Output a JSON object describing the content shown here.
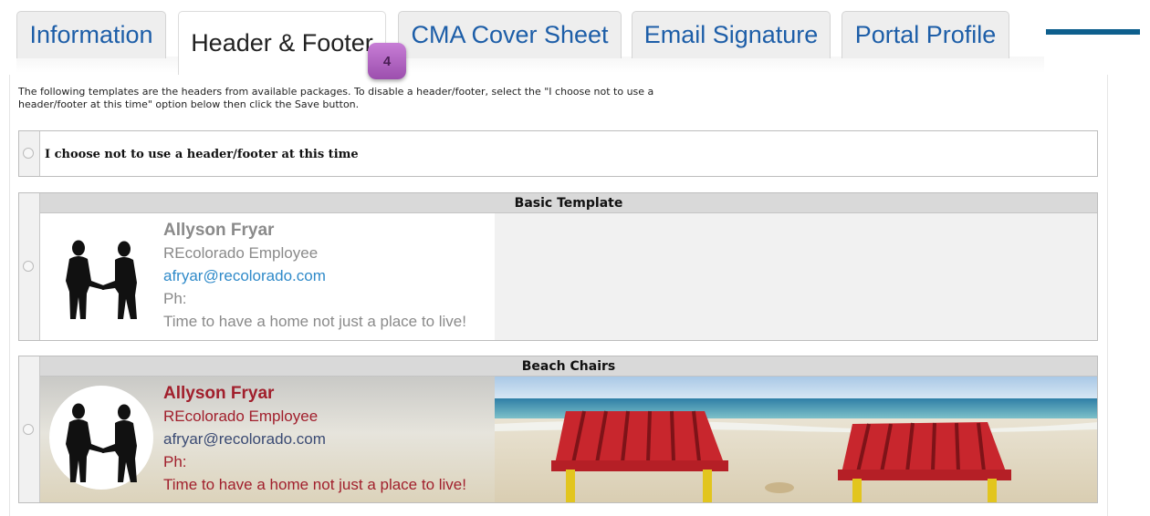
{
  "tabs": [
    {
      "label": "Information",
      "active": false
    },
    {
      "label": "Header & Footer",
      "active": true
    },
    {
      "label": "CMA Cover Sheet",
      "active": false
    },
    {
      "label": "Email Signature",
      "active": false
    },
    {
      "label": "Portal Profile",
      "active": false
    }
  ],
  "step_badge": "4",
  "intro_text": "The following templates are the headers from available packages. To disable a header/footer, select the \"I choose not to use a header/footer at this time\" option below then click the Save button.",
  "opt_out_label": "I choose not to use a header/footer at this time",
  "templates": [
    {
      "title": "Basic Template",
      "name": "Allyson Fryar",
      "role": "REcolorado Employee",
      "email": "afryar@recolorado.com",
      "phone": "Ph:",
      "tagline": "Time to have a home not just a place to live!"
    },
    {
      "title": "Beach Chairs",
      "name": "Allyson Fryar",
      "role": "REcolorado Employee",
      "email": "afryar@recolorado.com",
      "phone": "Ph:",
      "tagline": "Time to have a home not just a place to live!"
    }
  ],
  "colors": {
    "tab_link": "#1d5ea8",
    "accent": "#0e5f8d",
    "basic_text": "#8a8a8a",
    "basic_email": "#2f8ac9",
    "beach_name": "#a11f2c",
    "beach_email": "#3a4a73",
    "badge": "#b468c4"
  }
}
